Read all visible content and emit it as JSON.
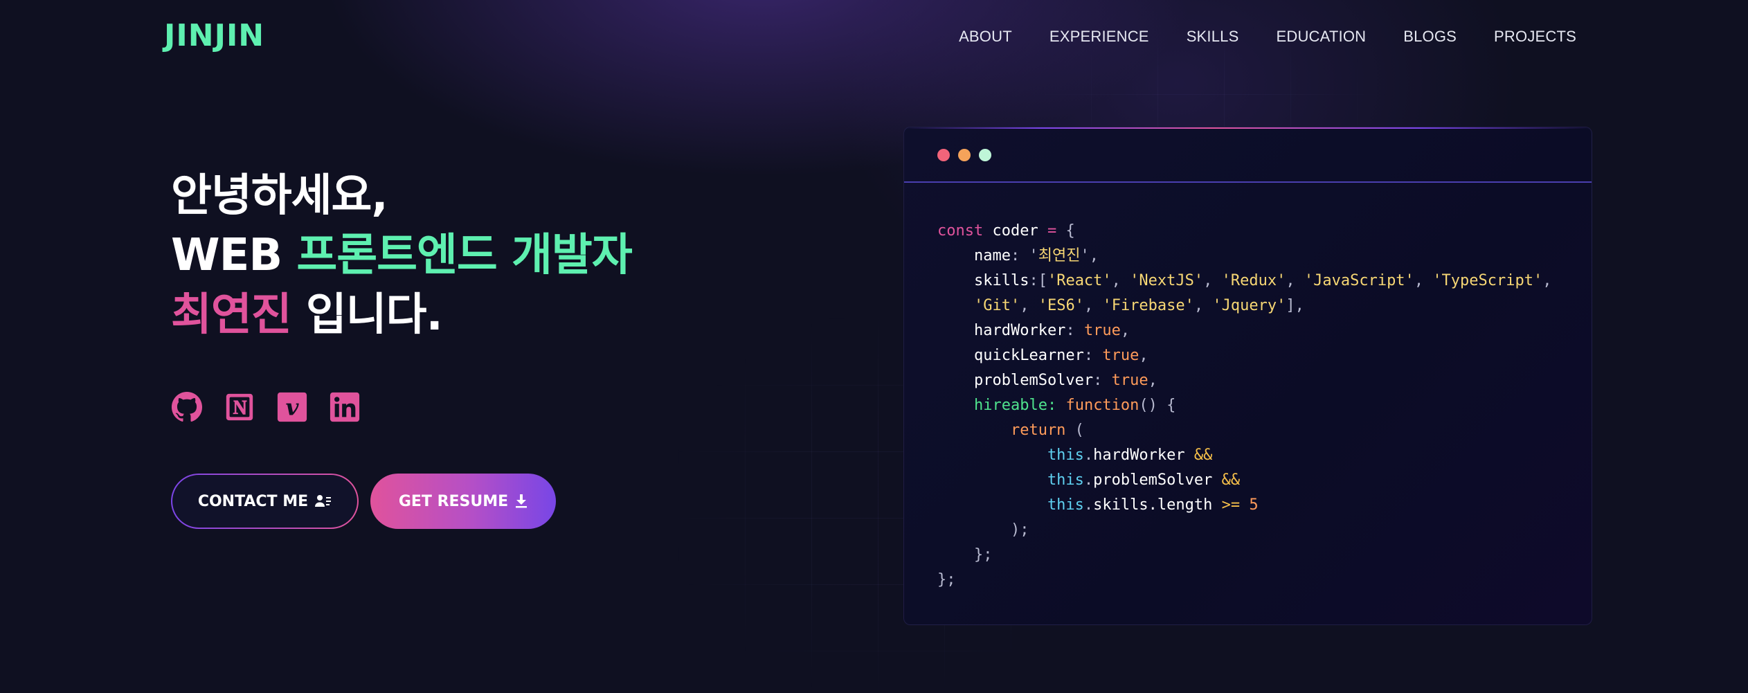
{
  "header": {
    "logo": "JINJIN",
    "nav": [
      "ABOUT",
      "EXPERIENCE",
      "SKILLS",
      "EDUCATION",
      "BLOGS",
      "PROJECTS"
    ]
  },
  "hero": {
    "line1": "안녕하세요,",
    "line2_white": "WEB ",
    "line2_green": "프론트엔드 개발자",
    "line3_pink": "최연진",
    "line3_white": " 입니다.",
    "socials": [
      "github-icon",
      "notion-icon",
      "vimeo-icon",
      "linkedin-icon"
    ],
    "buttons": {
      "contact_label": "CONTACT ME",
      "resume_label": "GET RESUME"
    }
  },
  "code_window": {
    "lines": [
      [
        {
          "t": "const ",
          "c": "kw"
        },
        {
          "t": "coder ",
          "c": "id"
        },
        {
          "t": "= ",
          "c": "kw"
        },
        {
          "t": "{",
          "c": "punct"
        }
      ],
      [
        {
          "t": "    name",
          "c": "id"
        },
        {
          "t": ": ",
          "c": "punct"
        },
        {
          "t": "'",
          "c": "punct"
        },
        {
          "t": "최연진",
          "c": "str"
        },
        {
          "t": "'",
          "c": "punct"
        },
        {
          "t": ",",
          "c": "punct"
        }
      ],
      [
        {
          "t": "    skills",
          "c": "id"
        },
        {
          "t": ":[",
          "c": "punct"
        },
        {
          "t": "'React'",
          "c": "str"
        },
        {
          "t": ", ",
          "c": "punct"
        },
        {
          "t": "'NextJS'",
          "c": "str"
        },
        {
          "t": ", ",
          "c": "punct"
        },
        {
          "t": "'Redux'",
          "c": "str"
        },
        {
          "t": ", ",
          "c": "punct"
        },
        {
          "t": "'JavaScript'",
          "c": "str"
        },
        {
          "t": ", ",
          "c": "punct"
        },
        {
          "t": "'TypeScript'",
          "c": "str"
        },
        {
          "t": ",",
          "c": "punct"
        }
      ],
      [
        {
          "t": "    ",
          "c": "punct"
        },
        {
          "t": "'Git'",
          "c": "str"
        },
        {
          "t": ", ",
          "c": "punct"
        },
        {
          "t": "'ES6'",
          "c": "str"
        },
        {
          "t": ", ",
          "c": "punct"
        },
        {
          "t": "'Firebase'",
          "c": "str"
        },
        {
          "t": ", ",
          "c": "punct"
        },
        {
          "t": "'Jquery'",
          "c": "str"
        },
        {
          "t": "],",
          "c": "punct"
        }
      ],
      [
        {
          "t": "    hardWorker",
          "c": "id"
        },
        {
          "t": ": ",
          "c": "punct"
        },
        {
          "t": "true",
          "c": "bool"
        },
        {
          "t": ",",
          "c": "punct"
        }
      ],
      [
        {
          "t": "    quickLearner",
          "c": "id"
        },
        {
          "t": ": ",
          "c": "punct"
        },
        {
          "t": "true",
          "c": "bool"
        },
        {
          "t": ",",
          "c": "punct"
        }
      ],
      [
        {
          "t": "    problemSolver",
          "c": "id"
        },
        {
          "t": ": ",
          "c": "punct"
        },
        {
          "t": "true",
          "c": "bool"
        },
        {
          "t": ",",
          "c": "punct"
        }
      ],
      [
        {
          "t": "    hireable",
          "c": "green"
        },
        {
          "t": ": ",
          "c": "green"
        },
        {
          "t": "function",
          "c": "fn"
        },
        {
          "t": "() {",
          "c": "punct"
        }
      ],
      [
        {
          "t": "        return",
          "c": "fn"
        },
        {
          "t": " (",
          "c": "punct"
        }
      ],
      [
        {
          "t": "            this",
          "c": "this"
        },
        {
          "t": ".",
          "c": "punct"
        },
        {
          "t": "hardWorker ",
          "c": "id"
        },
        {
          "t": "&&",
          "c": "op"
        }
      ],
      [
        {
          "t": "            this",
          "c": "this"
        },
        {
          "t": ".",
          "c": "punct"
        },
        {
          "t": "problemSolver ",
          "c": "id"
        },
        {
          "t": "&&",
          "c": "op"
        }
      ],
      [
        {
          "t": "            this",
          "c": "this"
        },
        {
          "t": ".",
          "c": "punct"
        },
        {
          "t": "skills.length ",
          "c": "id"
        },
        {
          "t": ">= ",
          "c": "op"
        },
        {
          "t": "5",
          "c": "num"
        }
      ],
      [
        {
          "t": "        );",
          "c": "punct"
        }
      ],
      [
        {
          "t": "    };",
          "c": "punct"
        }
      ],
      [
        {
          "t": "};",
          "c": "punct"
        }
      ]
    ]
  },
  "colors": {
    "background": "#0f1021",
    "accent_green": "#5ef0b0",
    "accent_pink": "#e0539c",
    "accent_purple": "#7b45e8"
  }
}
